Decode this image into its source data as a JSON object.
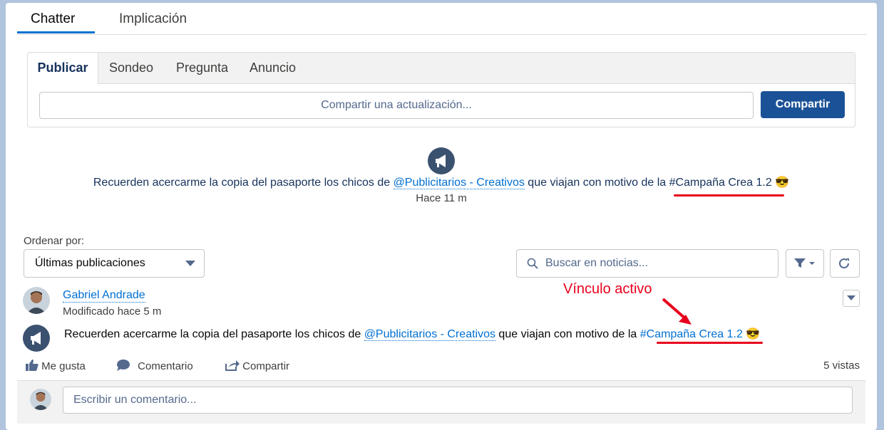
{
  "top_tabs": [
    "Chatter",
    "Implicación"
  ],
  "publisher": {
    "tabs": [
      "Publicar",
      "Sondeo",
      "Pregunta",
      "Anuncio"
    ],
    "input_placeholder": "Compartir una actualización...",
    "share_button": "Compartir"
  },
  "announcement": {
    "text_before": "Recuerden acercarme la copia del pasaporte los chicos de ",
    "mention": "@Publicitarios - Creativos",
    "text_middle": " que viajan con motivo de la ",
    "hashtag": "#Campaña Crea 1.2",
    "emoji": "😎",
    "time": "Hace 11 m"
  },
  "sort": {
    "label": "Ordenar por:",
    "value": "Últimas publicaciones"
  },
  "search": {
    "placeholder": "Buscar en noticias..."
  },
  "post": {
    "author": "Gabriel Andrade",
    "modified": "Modificado hace 5 m",
    "text_before": "Recuerden acercarme la copia del pasaporte los chicos de ",
    "mention": "@Publicitarios - Creativos",
    "text_middle": " que viajan con motivo de la ",
    "hashtag": "#Campaña Crea 1.2",
    "emoji": "😎",
    "actions": [
      "Me gusta",
      "Comentario",
      "Compartir"
    ],
    "views": "5 vistas"
  },
  "annotation": "Vínculo activo",
  "comment": {
    "placeholder": "Escribir un comentario..."
  },
  "colors": {
    "brand_blue": "#1b5297",
    "link_blue": "#0070d2",
    "annotation_red": "#e8001c"
  }
}
